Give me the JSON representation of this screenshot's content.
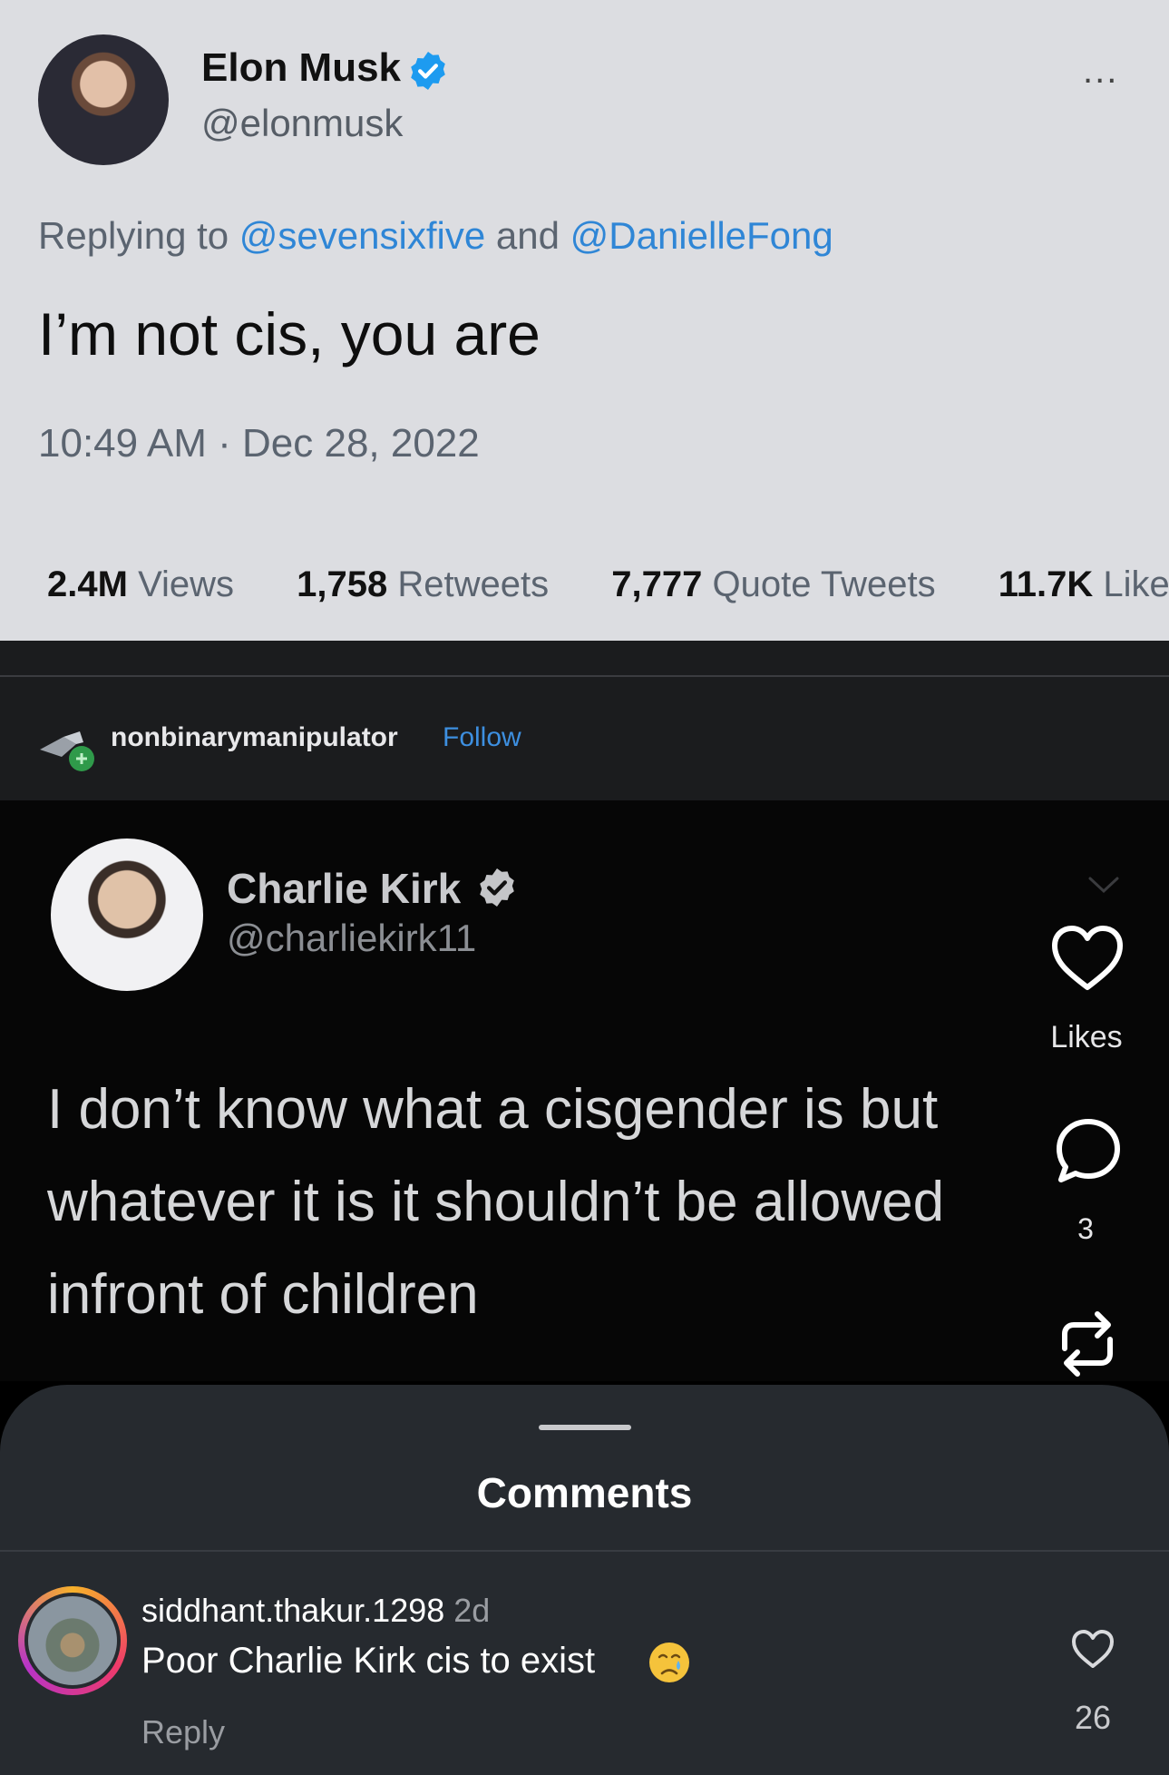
{
  "tweet1": {
    "name": "Elon Musk",
    "handle": "@elonmusk",
    "more_label": "...",
    "replying_prefix": "Replying to ",
    "mention1": "@sevensixfive",
    "replying_and": " and ",
    "mention2": "@DanielleFong",
    "text": "I’m not cis, you are",
    "timestamp": "10:49 AM · Dec 28, 2022",
    "stats": [
      {
        "value": "2.4M",
        "label": "Views"
      },
      {
        "value": "1,758",
        "label": "Retweets"
      },
      {
        "value": "7,777",
        "label": "Quote Tweets"
      },
      {
        "value": "11.7K",
        "label": "Like"
      }
    ]
  },
  "repost": {
    "username": "nonbinarymanipulator",
    "follow_label": "Follow"
  },
  "tweet2": {
    "name": "Charlie Kirk",
    "handle": "@charliekirk11",
    "text": "I don’t know what a cisgender is but whatever it is it shouldn’t be allowed infront of children"
  },
  "side_actions": {
    "likes_label": "Likes",
    "comment_count": "3"
  },
  "comments_sheet": {
    "title": "Comments",
    "comment": {
      "username": "siddhant.thakur.1298",
      "time": "2d",
      "text": "Poor Charlie Kirk cis to exist",
      "reply_label": "Reply",
      "like_count": "26"
    }
  },
  "colors": {
    "verified_blue": "#1d9bf0",
    "link_blue": "#2f86d6",
    "follow_blue": "#3d8fe0"
  }
}
